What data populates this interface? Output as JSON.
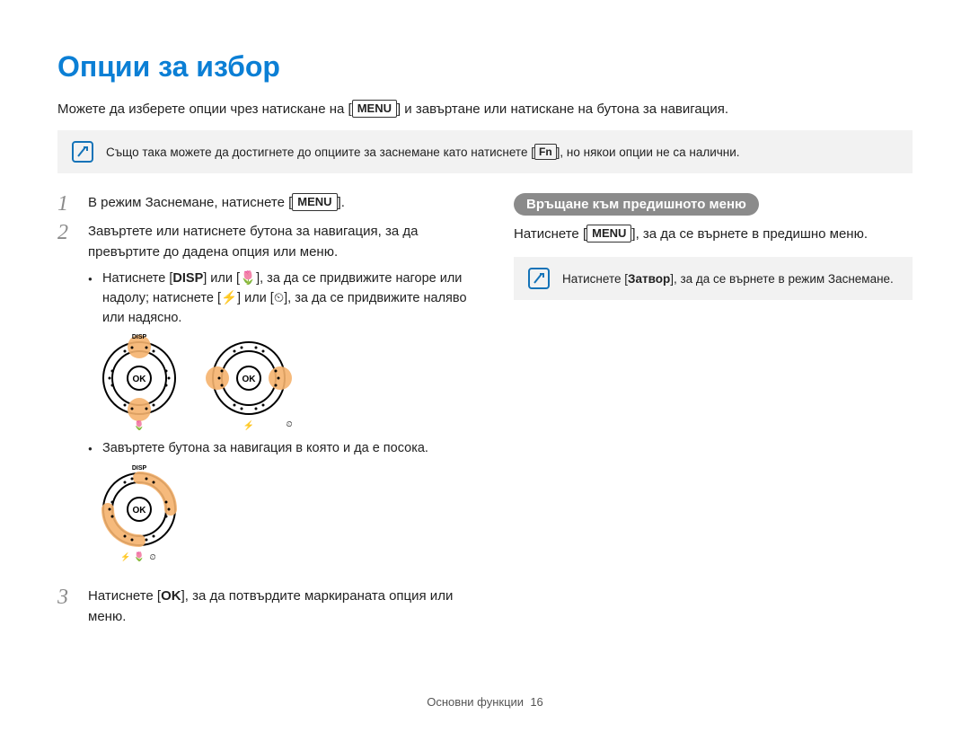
{
  "title": "Опции за избор",
  "intro_before": "Можете да изберете опции чрез натискане на ",
  "intro_key": "MENU",
  "intro_after": " и завъртане или натискане на бутона за навигация.",
  "top_note_before": "Също така можете да достигнете до опциите за заснемане като натиснете ",
  "top_note_key": "Fn",
  "top_note_after": ", но някои опции не са налични.",
  "steps": {
    "one": {
      "num": "1",
      "before": "В режим Заснемане, натиснете ",
      "key": "MENU",
      "after": "."
    },
    "two": {
      "num": "2",
      "text": "Завъртете или натиснете бутона за навигация, за да превъртите до дадена опция или меню.",
      "bullet1_a": "Натиснете [",
      "bullet1_disp": "DISP",
      "bullet1_b": "] или [",
      "bullet1_macro": "🌷",
      "bullet1_c": "], за да се придвижите нагоре или надолу; натиснете [",
      "bullet1_flash": "⚡",
      "bullet1_d": "] или [",
      "bullet1_timer": "⏲",
      "bullet1_e": "], за да се придвижите наляво или надясно.",
      "bullet2": "Завъртете бутона за навигация в която и да е посока."
    },
    "three": {
      "num": "3",
      "before": "Натиснете [",
      "key": "OK",
      "after": "], за да потвърдите маркираната опция или меню."
    }
  },
  "right": {
    "pill": "Връщане към предишното меню",
    "para_before": "Натиснете ",
    "para_key": "MENU",
    "para_after": ", за да се върнете в предишно меню.",
    "note_before": "Натиснете [",
    "note_key": "Затвор",
    "note_after": "], за да се върнете в режим Заснемане."
  },
  "dial_labels": {
    "ok": "OK",
    "disp": "DISP",
    "macro": "🌷",
    "flash": "⚡",
    "timer": "⏲"
  },
  "footer": {
    "section": "Основни функции",
    "page": "16"
  }
}
